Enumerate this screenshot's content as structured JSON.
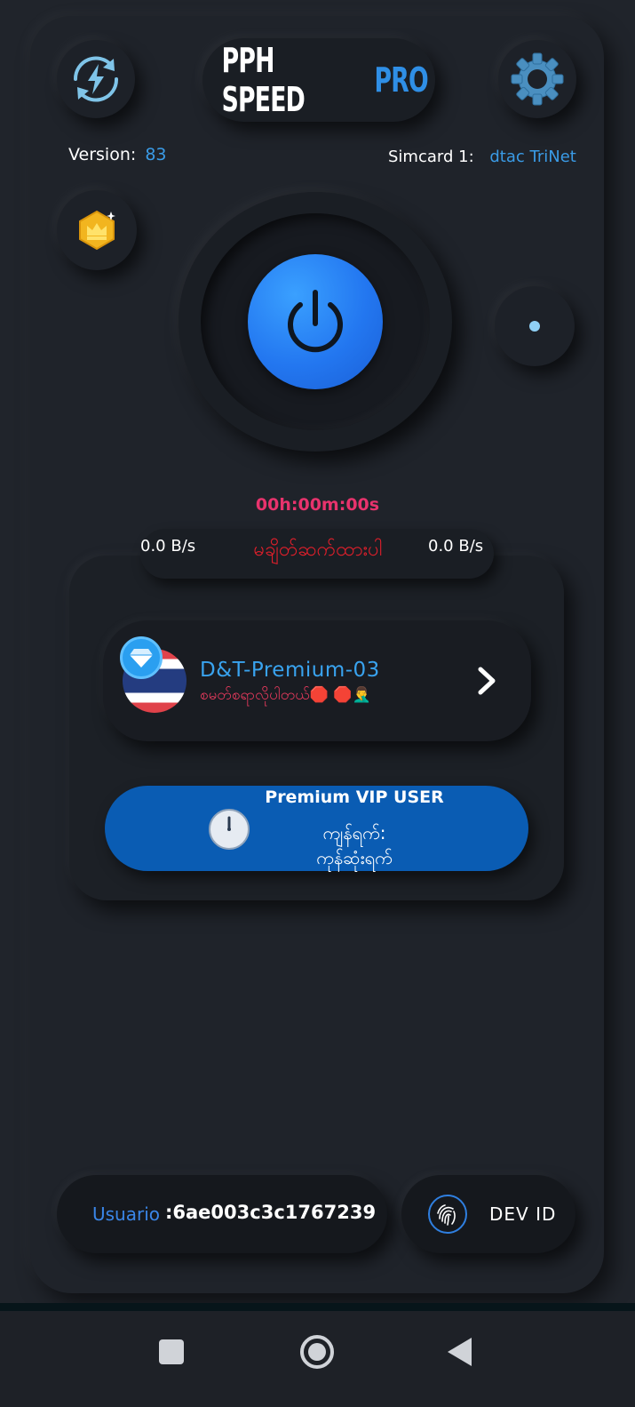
{
  "header": {
    "title_main": "PPH SPEED",
    "title_accent": "PRO",
    "left_icon": "refresh-bolt-icon",
    "right_icon": "gear-icon"
  },
  "info": {
    "version_label": "Version:",
    "version_value": "83",
    "sim_label": "Simcard 1:",
    "sim_value": "dtac TriNet"
  },
  "crown_icon": "crown-badge-icon",
  "power": {
    "icon": "power-icon",
    "side_icon": "dot-indicator-icon"
  },
  "connection": {
    "timer": "00h:00m:00s",
    "upload_speed": "0.0 B/s",
    "download_speed": "0.0 B/s",
    "status": "မချိတ်ဆက်ထားပါ"
  },
  "server": {
    "name": "D&T-Premium-03",
    "subtitle": "စမတ်စရာလိုပါတယ်🛑 🛑🤦‍♂️",
    "flag_icon": "thailand-flag-icon",
    "badge_icon": "diamond-badge-icon",
    "chevron_icon": "chevron-right-icon"
  },
  "vip": {
    "title": "Premium VIP USER",
    "line1": "ကျန်ရက်:",
    "line2": "ကုန်ဆုံးရက်",
    "icon": "clock-icon"
  },
  "footer": {
    "user_label": "Usuario",
    "user_value": ":6ae003c3c1767239",
    "dev_label": "DEV ID",
    "dev_icon": "fingerprint-icon"
  },
  "colors": {
    "background": "#20242b",
    "accent_blue": "#2f8fe6",
    "power_blue": "#2377f0",
    "status_red": "#e21f2b",
    "timer_pink": "#e8336d",
    "vip_blue": "#0a5cb3"
  }
}
